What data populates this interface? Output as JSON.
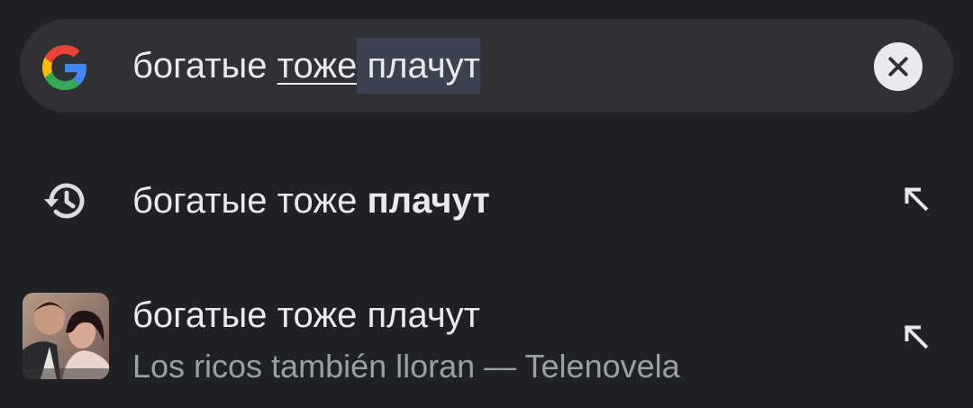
{
  "search": {
    "query_prefix": "богатые ",
    "query_underlined": "тоже",
    "query_selected": " плачут",
    "clear_icon": "close-icon",
    "logo_icon": "google-g-icon"
  },
  "suggestions": [
    {
      "icon": "history-icon",
      "text_normal": "богатые тоже ",
      "text_bold": "плачут",
      "action_icon": "arrow-up-left-icon"
    },
    {
      "icon": "thumbnail-image",
      "text": "богатые тоже плачут",
      "subtitle": "Los ricos también lloran — Telenovela",
      "action_icon": "arrow-up-left-icon"
    }
  ],
  "colors": {
    "background": "#202124",
    "search_bar": "#303134",
    "text": "#e8eaed",
    "subtitle": "#9aa0a6",
    "selection": "#3c4250"
  }
}
